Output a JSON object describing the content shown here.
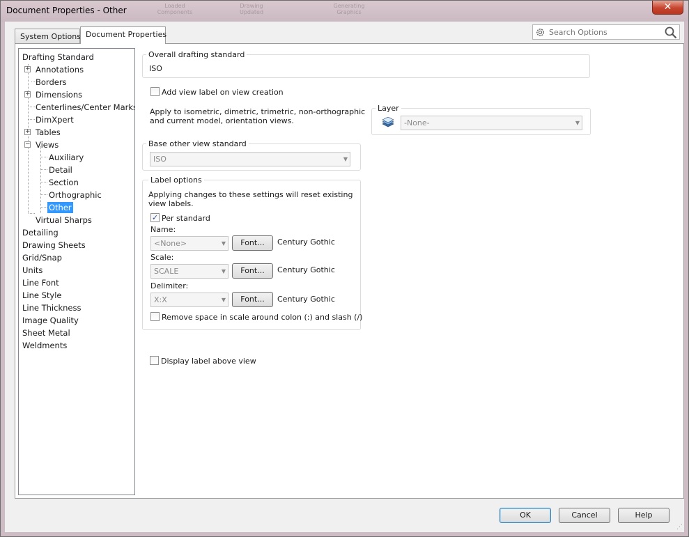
{
  "window": {
    "title": "Document Properties - Other",
    "background_tabs": [
      "Loaded\nComponents",
      "Drawing\nUpdated",
      "Generating\nGraphics"
    ],
    "close_glyph": "✕"
  },
  "tabs": [
    {
      "label": "System Options"
    },
    {
      "label": "Document Properties"
    }
  ],
  "search": {
    "placeholder": "Search Options"
  },
  "tree": {
    "items": [
      {
        "label": "Drafting Standard"
      },
      {
        "label": "Annotations"
      },
      {
        "label": "Borders"
      },
      {
        "label": "Dimensions"
      },
      {
        "label": "Centerlines/Center Marks"
      },
      {
        "label": "DimXpert"
      },
      {
        "label": "Tables"
      },
      {
        "label": "Views"
      },
      {
        "label": "Auxiliary"
      },
      {
        "label": "Detail"
      },
      {
        "label": "Section"
      },
      {
        "label": "Orthographic"
      },
      {
        "label": "Other"
      },
      {
        "label": "Virtual Sharps"
      },
      {
        "label": "Detailing"
      },
      {
        "label": "Drawing Sheets"
      },
      {
        "label": "Grid/Snap"
      },
      {
        "label": "Units"
      },
      {
        "label": "Line Font"
      },
      {
        "label": "Line Style"
      },
      {
        "label": "Line Thickness"
      },
      {
        "label": "Image Quality"
      },
      {
        "label": "Sheet Metal"
      },
      {
        "label": "Weldments"
      }
    ],
    "expander_plus": "+",
    "expander_minus": "−",
    "selected": "Other"
  },
  "overall": {
    "label": "Overall drafting standard",
    "value": "ISO"
  },
  "add_view_label": {
    "label": "Add view label on view creation",
    "checked": false
  },
  "apply_text": {
    "line1": "Apply to isometric, dimetric, trimetric, non-orthographic",
    "line2": "and current model, orientation views."
  },
  "layer": {
    "label": "Layer",
    "value": "-None-",
    "icon": "layer-stack-icon"
  },
  "base_standard": {
    "label": "Base other view standard",
    "value": "ISO"
  },
  "label_options": {
    "label": "Label options",
    "note_line1": "Applying changes to these settings will reset existing",
    "note_line2": "view labels.",
    "per_standard": {
      "label": "Per standard",
      "checked": true,
      "mark": "✓"
    },
    "name": {
      "label": "Name:",
      "value": "<None>",
      "font_button": "Font...",
      "font": "Century Gothic"
    },
    "scale": {
      "label": "Scale:",
      "value": "SCALE",
      "font_button": "Font...",
      "font": "Century Gothic"
    },
    "delimiter": {
      "label": "Delimiter:",
      "value": "X:X",
      "font_button": "Font...",
      "font": "Century Gothic"
    },
    "remove_space": {
      "label": "Remove space in scale around colon (:) and slash (/)",
      "checked": false
    }
  },
  "display_above": {
    "label": "Display label above view",
    "checked": false
  },
  "buttons": {
    "ok": "OK",
    "cancel": "Cancel",
    "help": "Help"
  },
  "combo_arrow": "▼"
}
